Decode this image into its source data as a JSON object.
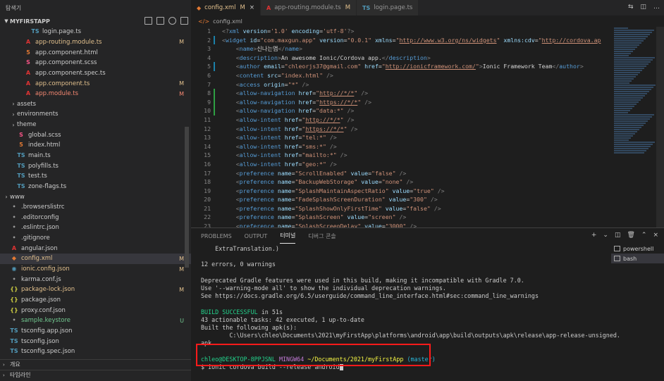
{
  "sidebar": {
    "header": "탐색기",
    "section_title": "MYFIRSTAPP",
    "files": [
      {
        "name": "login.page.ts",
        "icon": "ts",
        "indent": 3,
        "badge": "",
        "status": ""
      },
      {
        "name": "app-routing.module.ts",
        "icon": "angular",
        "indent": 2,
        "badge": "M",
        "status": "mod"
      },
      {
        "name": "app.component.html",
        "icon": "html",
        "indent": 2,
        "badge": "",
        "status": ""
      },
      {
        "name": "app.component.scss",
        "icon": "scss",
        "indent": 2,
        "badge": "",
        "status": ""
      },
      {
        "name": "app.component.spec.ts",
        "icon": "angular",
        "indent": 2,
        "badge": "",
        "status": ""
      },
      {
        "name": "app.component.ts",
        "icon": "angular",
        "indent": 2,
        "badge": "M",
        "status": "mod"
      },
      {
        "name": "app.module.ts",
        "icon": "angular",
        "indent": 2,
        "badge": "M",
        "status": "err"
      },
      {
        "name": "assets",
        "icon": "folder",
        "indent": 1,
        "badge": "",
        "status": "",
        "folder": true
      },
      {
        "name": "environments",
        "icon": "folder",
        "indent": 1,
        "badge": "",
        "status": "",
        "folder": true
      },
      {
        "name": "theme",
        "icon": "folder",
        "indent": 1,
        "badge": "",
        "status": "",
        "folder": true
      },
      {
        "name": "global.scss",
        "icon": "scss",
        "indent": 1,
        "badge": "",
        "status": ""
      },
      {
        "name": "index.html",
        "icon": "html",
        "indent": 1,
        "badge": "",
        "status": ""
      },
      {
        "name": "main.ts",
        "icon": "ts",
        "indent": 1,
        "badge": "",
        "status": ""
      },
      {
        "name": "polyfills.ts",
        "icon": "ts",
        "indent": 1,
        "badge": "",
        "status": ""
      },
      {
        "name": "test.ts",
        "icon": "ts",
        "indent": 1,
        "badge": "",
        "status": ""
      },
      {
        "name": "zone-flags.ts",
        "icon": "ts",
        "indent": 1,
        "badge": "",
        "status": ""
      },
      {
        "name": "www",
        "icon": "folder",
        "indent": 0,
        "badge": "",
        "status": "",
        "folder": true
      },
      {
        "name": ".browserslistrc",
        "icon": "misc",
        "indent": 0,
        "badge": "",
        "status": ""
      },
      {
        "name": ".editorconfig",
        "icon": "misc",
        "indent": 0,
        "badge": "",
        "status": ""
      },
      {
        "name": ".eslintrc.json",
        "icon": "misc",
        "indent": 0,
        "badge": "",
        "status": ""
      },
      {
        "name": ".gitignore",
        "icon": "misc",
        "indent": 0,
        "badge": "",
        "status": ""
      },
      {
        "name": "angular.json",
        "icon": "angular",
        "indent": 0,
        "badge": "",
        "status": ""
      },
      {
        "name": "config.xml",
        "icon": "xml",
        "indent": 0,
        "badge": "M",
        "status": "mod",
        "selected": true
      },
      {
        "name": "ionic.config.json",
        "icon": "ionic",
        "indent": 0,
        "badge": "M",
        "status": "mod"
      },
      {
        "name": "karma.conf.js",
        "icon": "misc",
        "indent": 0,
        "badge": "",
        "status": ""
      },
      {
        "name": "package-lock.json",
        "icon": "json",
        "indent": 0,
        "badge": "M",
        "status": "mod"
      },
      {
        "name": "package.json",
        "icon": "json",
        "indent": 0,
        "badge": "",
        "status": ""
      },
      {
        "name": "proxy.conf.json",
        "icon": "json",
        "indent": 0,
        "badge": "",
        "status": ""
      },
      {
        "name": "sample.keystore",
        "icon": "misc",
        "indent": 0,
        "badge": "U",
        "status": "unt"
      },
      {
        "name": "tsconfig.app.json",
        "icon": "ts",
        "indent": 0,
        "badge": "",
        "status": ""
      },
      {
        "name": "tsconfig.json",
        "icon": "ts",
        "indent": 0,
        "badge": "",
        "status": ""
      },
      {
        "name": "tsconfig.spec.json",
        "icon": "ts",
        "indent": 0,
        "badge": "",
        "status": ""
      }
    ],
    "outline_label": "개요",
    "timeline_label": "타임라인"
  },
  "tabs": [
    {
      "label": "config.xml",
      "mark": "M",
      "close": "×",
      "active": true,
      "icon": "xml"
    },
    {
      "label": "app-routing.module.ts",
      "mark": "M",
      "close": "",
      "active": false,
      "icon": "angular"
    },
    {
      "label": "login.page.ts",
      "mark": "",
      "close": "",
      "active": false,
      "icon": "ts"
    }
  ],
  "breadcrumb": "config.xml",
  "code_lines": [
    {
      "n": "1",
      "html": "<span class='p'>&lt;?</span><span class='t'>xml</span> <span class='a'>version</span>=<span class='s'>'1.0'</span> <span class='a'>encoding</span>=<span class='s'>'utf-8'</span><span class='p'>?&gt;</span>",
      "gut": ""
    },
    {
      "n": "2",
      "html": "<span class='p'>&lt;</span><span class='t'>widget</span> <span class='a'>id</span>=<span class='s'>\"com.maxgun.app\"</span> <span class='a'>version</span>=<span class='s'>\"0.0.1\"</span> <span class='a'>xmlns</span>=<span class='s'>\"</span><span class='u'>http://www.w3.org/ns/widgets</span><span class='s'>\"</span> <span class='a'>xmlns:cdv</span>=<span class='s'>\"</span><span class='u'>http://cordova.ap</span>",
      "gut": "b"
    },
    {
      "n": "3",
      "html": "    <span class='p'>&lt;</span><span class='t'>name</span><span class='p'>&gt;</span>신나는앱<span class='p'>&lt;/</span><span class='t'>name</span><span class='p'>&gt;</span>",
      "gut": ""
    },
    {
      "n": "4",
      "html": "    <span class='p'>&lt;</span><span class='t'>description</span><span class='p'>&gt;</span>An awesome Ionic/Cordova app.<span class='p'>&lt;/</span><span class='t'>description</span><span class='p'>&gt;</span>",
      "gut": ""
    },
    {
      "n": "5",
      "html": "    <span class='p'>&lt;</span><span class='t'>author</span> <span class='a'>email</span>=<span class='s'>\"chleorjs37@gmail.com\"</span> <span class='a'>href</span>=<span class='s'>\"</span><span class='u'>http://ionicframework.com/</span><span class='s'>\"</span><span class='p'>&gt;</span>Ionic Framework Team<span class='p'>&lt;/</span><span class='t'>author</span><span class='p'>&gt;</span>",
      "gut": "b"
    },
    {
      "n": "6",
      "html": "    <span class='p'>&lt;</span><span class='t'>content</span> <span class='a'>src</span>=<span class='s'>\"index.html\"</span> <span class='p'>/&gt;</span>",
      "gut": ""
    },
    {
      "n": "7",
      "html": "    <span class='p'>&lt;</span><span class='t'>access</span> <span class='a'>origin</span>=<span class='s'>\"*\"</span> <span class='p'>/&gt;</span>",
      "gut": ""
    },
    {
      "n": "8",
      "html": "    <span class='p'>&lt;</span><span class='t'>allow-navigation</span> <span class='a'>href</span>=<span class='s'>\"</span><span class='u'>http://*/*</span><span class='s'>\"</span> <span class='p'>/&gt;</span>",
      "gut": "g"
    },
    {
      "n": "9",
      "html": "    <span class='p'>&lt;</span><span class='t'>allow-navigation</span> <span class='a'>href</span>=<span class='s'>\"</span><span class='u'>https://*/*</span><span class='s'>\"</span> <span class='p'>/&gt;</span>",
      "gut": "g"
    },
    {
      "n": "10",
      "html": "    <span class='p'>&lt;</span><span class='t'>allow-navigation</span> <span class='a'>href</span>=<span class='s'>\"data:*\"</span> <span class='p'>/&gt;</span>",
      "gut": "g"
    },
    {
      "n": "11",
      "html": "    <span class='p'>&lt;</span><span class='t'>allow-intent</span> <span class='a'>href</span>=<span class='s'>\"</span><span class='u'>http://*/*</span><span class='s'>\"</span> <span class='p'>/&gt;</span>",
      "gut": ""
    },
    {
      "n": "12",
      "html": "    <span class='p'>&lt;</span><span class='t'>allow-intent</span> <span class='a'>href</span>=<span class='s'>\"</span><span class='u'>https://*/*</span><span class='s'>\"</span> <span class='p'>/&gt;</span>",
      "gut": ""
    },
    {
      "n": "13",
      "html": "    <span class='p'>&lt;</span><span class='t'>allow-intent</span> <span class='a'>href</span>=<span class='s'>\"tel:*\"</span> <span class='p'>/&gt;</span>",
      "gut": ""
    },
    {
      "n": "14",
      "html": "    <span class='p'>&lt;</span><span class='t'>allow-intent</span> <span class='a'>href</span>=<span class='s'>\"sms:*\"</span> <span class='p'>/&gt;</span>",
      "gut": ""
    },
    {
      "n": "15",
      "html": "    <span class='p'>&lt;</span><span class='t'>allow-intent</span> <span class='a'>href</span>=<span class='s'>\"mailto:*\"</span> <span class='p'>/&gt;</span>",
      "gut": ""
    },
    {
      "n": "16",
      "html": "    <span class='p'>&lt;</span><span class='t'>allow-intent</span> <span class='a'>href</span>=<span class='s'>\"geo:*\"</span> <span class='p'>/&gt;</span>",
      "gut": ""
    },
    {
      "n": "17",
      "html": "    <span class='p'>&lt;</span><span class='t'>preference</span> <span class='a'>name</span>=<span class='s'>\"ScrollEnabled\"</span> <span class='a'>value</span>=<span class='s'>\"false\"</span> <span class='p'>/&gt;</span>",
      "gut": ""
    },
    {
      "n": "18",
      "html": "    <span class='p'>&lt;</span><span class='t'>preference</span> <span class='a'>name</span>=<span class='s'>\"BackupWebStorage\"</span> <span class='a'>value</span>=<span class='s'>\"none\"</span> <span class='p'>/&gt;</span>",
      "gut": ""
    },
    {
      "n": "19",
      "html": "    <span class='p'>&lt;</span><span class='t'>preference</span> <span class='a'>name</span>=<span class='s'>\"SplashMaintainAspectRatio\"</span> <span class='a'>value</span>=<span class='s'>\"true\"</span> <span class='p'>/&gt;</span>",
      "gut": ""
    },
    {
      "n": "20",
      "html": "    <span class='p'>&lt;</span><span class='t'>preference</span> <span class='a'>name</span>=<span class='s'>\"FadeSplashScreenDuration\"</span> <span class='a'>value</span>=<span class='s'>\"300\"</span> <span class='p'>/&gt;</span>",
      "gut": ""
    },
    {
      "n": "21",
      "html": "    <span class='p'>&lt;</span><span class='t'>preference</span> <span class='a'>name</span>=<span class='s'>\"SplashShowOnlyFirstTime\"</span> <span class='a'>value</span>=<span class='s'>\"false\"</span> <span class='p'>/&gt;</span>",
      "gut": ""
    },
    {
      "n": "22",
      "html": "    <span class='p'>&lt;</span><span class='t'>preference</span> <span class='a'>name</span>=<span class='s'>\"SplashScreen\"</span> <span class='a'>value</span>=<span class='s'>\"screen\"</span> <span class='p'>/&gt;</span>",
      "gut": ""
    },
    {
      "n": "23",
      "html": "    <span class='p'>&lt;</span><span class='t'>preference</span> <span class='a'>name</span>=<span class='s'>\"SplashScreenDelay\"</span> <span class='a'>value</span>=<span class='s'>\"3000\"</span> <span class='p'>/&gt;</span>",
      "gut": ""
    }
  ],
  "panel": {
    "tabs": [
      "PROBLEMS",
      "OUTPUT",
      "터미널",
      "디버그 콘솔"
    ],
    "active_tab": 2,
    "shells": [
      "powershell",
      "bash"
    ],
    "active_shell": 1,
    "lines": [
      {
        "text": "    ExtraTranslation.)",
        "cls": ""
      },
      {
        "text": "",
        "cls": ""
      },
      {
        "text": "12 errors, 0 warnings",
        "cls": ""
      },
      {
        "text": "",
        "cls": ""
      },
      {
        "text": "Deprecated Gradle features were used in this build, making it incompatible with Gradle 7.0.",
        "cls": ""
      },
      {
        "text": "Use '--warning-mode all' to show the individual deprecation warnings.",
        "cls": ""
      },
      {
        "text": "See https://docs.gradle.org/6.5/userguide/command_line_interface.html#sec:command_line_warnings",
        "cls": ""
      },
      {
        "text": "",
        "cls": ""
      },
      {
        "text": "BUILD SUCCESSFUL",
        "cls": "green",
        "rest": " in 51s"
      },
      {
        "text": "43 actionable tasks: 42 executed, 1 up-to-date",
        "cls": ""
      },
      {
        "text": "Built the following apk(s):",
        "cls": ""
      },
      {
        "text": "        C:\\Users\\chleo\\Documents\\2021\\myFirstApp\\platforms\\android\\app\\build\\outputs\\apk\\release\\app-release-unsigned.",
        "cls": ""
      },
      {
        "text": "apk",
        "cls": ""
      },
      {
        "text": "",
        "cls": ""
      }
    ],
    "prompt_user": "chleo@DESKTOP-8PPJSNL",
    "prompt_env": "MINGW64",
    "prompt_path": "~/Documents/2021/myFirstApp",
    "prompt_branch": "(master)",
    "command": "$ ionic cordova build --release android"
  },
  "colors": {
    "highlight_box": "#ff1a1a",
    "modified": "#e2c08d",
    "untracked": "#73c991",
    "success": "#23d18b"
  }
}
